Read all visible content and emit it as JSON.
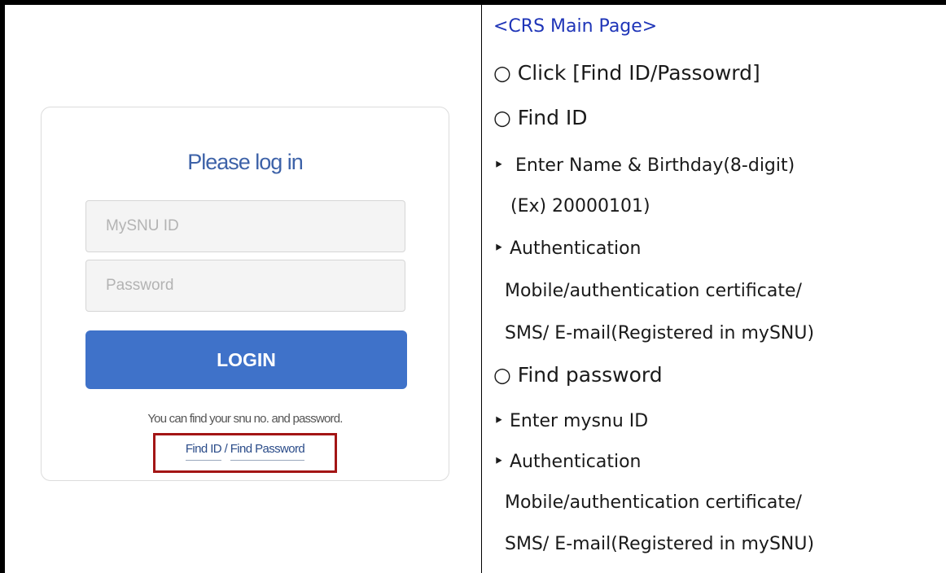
{
  "login_card": {
    "title": "Please log in",
    "id_placeholder": "MySNU ID",
    "password_placeholder": "Password",
    "login_label": "LOGIN",
    "help_text": "You can find your snu no. and password.",
    "find_id_label": "Find ID",
    "separator": "/",
    "find_password_label": "Find Password"
  },
  "instructions": {
    "heading": "<CRS Main Page>",
    "lines": [
      "○ Click [Find ID/Passowrd]",
      "○ Find ID",
      "‣  Enter Name & Birthday(8-digit)",
      "   (Ex) 20000101)",
      "‣ Authentication",
      "  Mobile/authentication certificate/",
      "  SMS/ E-mail(Registered in mySNU)",
      "○ Find password",
      "‣ Enter mysnu ID",
      "‣ Authentication",
      "  Mobile/authentication certificate/",
      "  SMS/ E-mail(Registered in mySNU)"
    ]
  },
  "colors": {
    "accent_blue": "#3f72c9",
    "heading_blue": "#1f35b8",
    "highlight_red": "#a31515"
  }
}
